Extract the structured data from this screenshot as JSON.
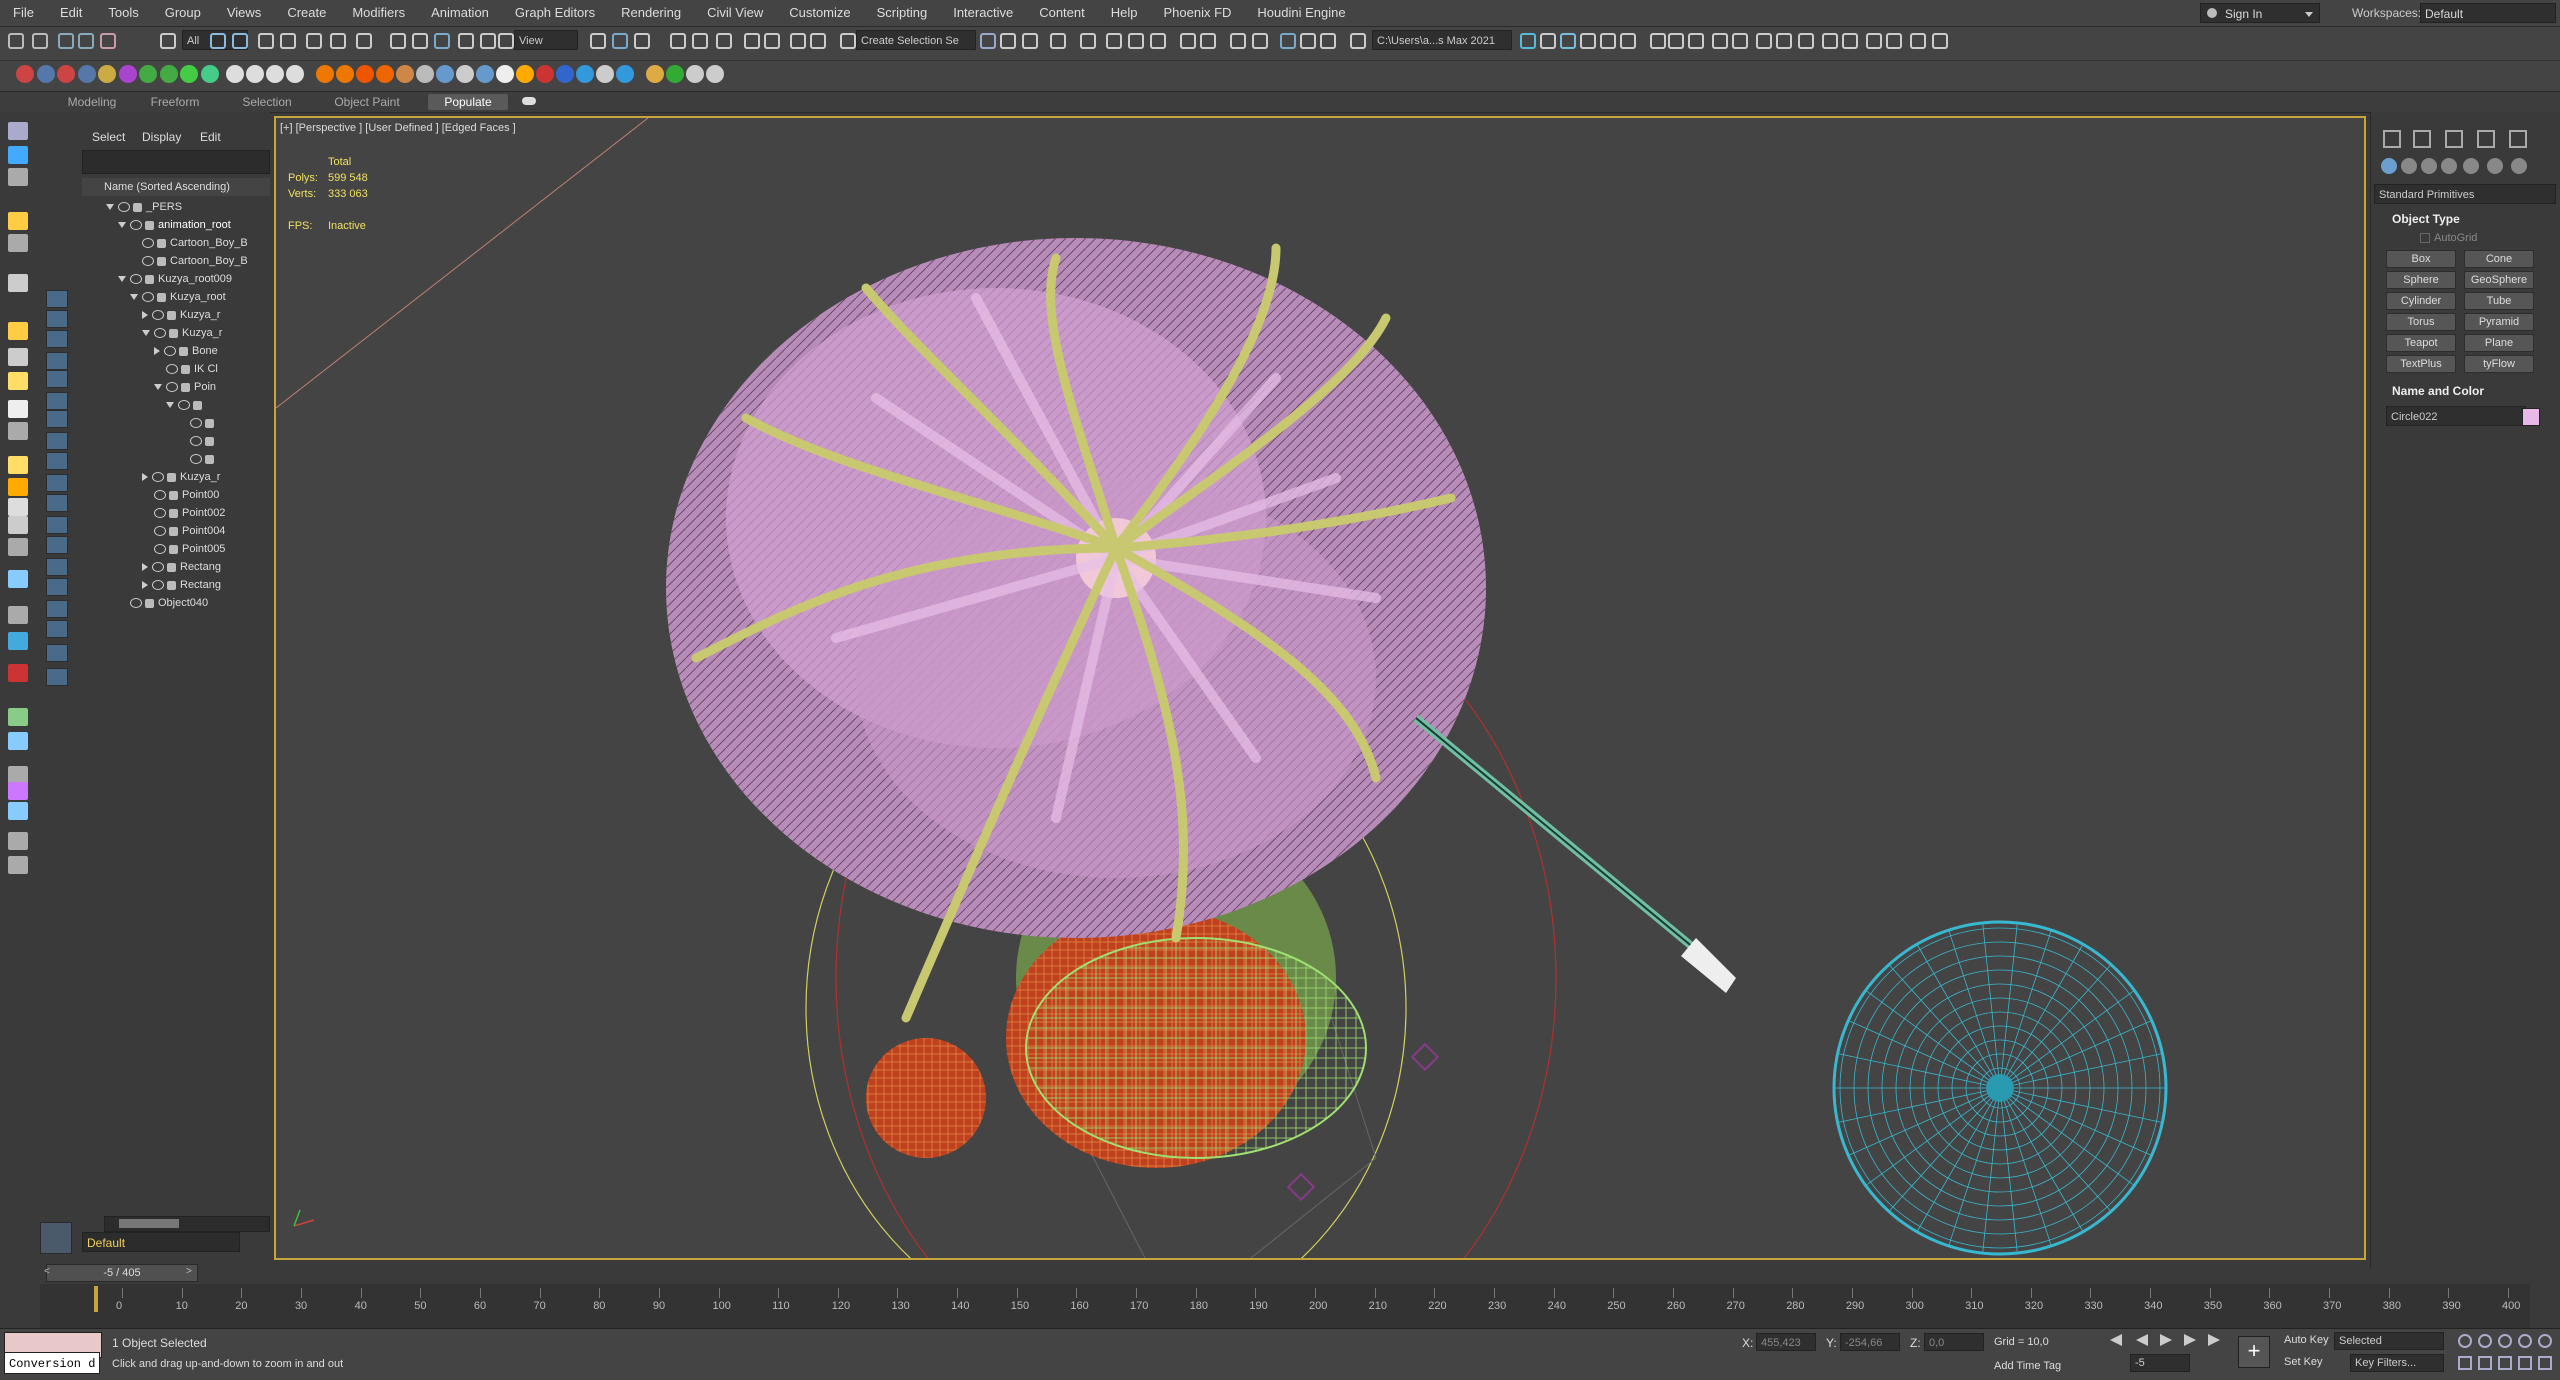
{
  "menubar": {
    "items": [
      "File",
      "Edit",
      "Tools",
      "Group",
      "Views",
      "Create",
      "Modifiers",
      "Animation",
      "Graph Editors",
      "Rendering",
      "Civil View",
      "Customize",
      "Scripting",
      "Interactive",
      "Content",
      "Help",
      "Phoenix FD",
      "Houdini Engine"
    ],
    "sign_in": "Sign In",
    "workspaces_label": "Workspaces:",
    "workspace_value": "Default"
  },
  "toolbar": {
    "selection_filter": "All",
    "ref_coord": "View",
    "selection_set": "Create Selection Se",
    "path": "C:\\Users\\a...s Max 2021"
  },
  "ribbon": {
    "tabs": [
      "Modeling",
      "Freeform",
      "Selection",
      "Object Paint",
      "Populate"
    ],
    "active": "Populate"
  },
  "scene_explorer": {
    "menu": [
      "Select",
      "Display",
      "Edit"
    ],
    "header": "Name (Sorted Ascending)",
    "rows": [
      "_PERS",
      "animation_root",
      "Cartoon_Boy_B",
      "Cartoon_Boy_B",
      "Kuzya_root009",
      "Kuzya_root",
      "Kuzya_r",
      "Kuzya_r",
      "Bone",
      "IK Cl",
      "Poin",
      "",
      "",
      "",
      "",
      "Kuzya_r",
      "Point00",
      "Point002",
      "Point004",
      "Point005",
      "Rectang",
      "Rectang",
      "Object040"
    ],
    "layer": "Default"
  },
  "viewport": {
    "label": "[+] [Perspective ] [User Defined ] [Edged Faces ]",
    "stats_total": "Total",
    "polys_label": "Polys:",
    "polys_value": "599 548",
    "verts_label": "Verts:",
    "verts_value": "333 063",
    "fps_label": "FPS:",
    "fps_value": "Inactive"
  },
  "command_panel": {
    "category": "Standard Primitives",
    "object_type_title": "Object Type",
    "autogrid": "AutoGrid",
    "buttons": [
      "Box",
      "Cone",
      "Sphere",
      "GeoSphere",
      "Cylinder",
      "Tube",
      "Torus",
      "Pyramid",
      "Teapot",
      "Plane",
      "TextPlus",
      "tyFlow"
    ],
    "name_color_title": "Name and Color",
    "object_name": "Circle022",
    "object_color": "#e8b8e8"
  },
  "timeline": {
    "frame_indicator": "-5 / 405",
    "ticks": [
      "0",
      "10",
      "20",
      "30",
      "40",
      "50",
      "60",
      "70",
      "80",
      "90",
      "100",
      "110",
      "120",
      "130",
      "140",
      "150",
      "160",
      "170",
      "180",
      "190",
      "200",
      "210",
      "220",
      "230",
      "240",
      "250",
      "260",
      "270",
      "280",
      "290",
      "300",
      "310",
      "320",
      "330",
      "340",
      "350",
      "360",
      "370",
      "380",
      "390",
      "400"
    ]
  },
  "status": {
    "maxscript": "Conversion d",
    "selected": "1 Object Selected",
    "prompt": "Click and drag up-and-down to zoom in and out",
    "x_label": "X:",
    "x_value": "455,423",
    "y_label": "Y:",
    "y_value": "-254,66",
    "z_label": "Z:",
    "z_value": "0,0",
    "grid": "Grid = 10,0",
    "add_time_tag": "Add Time Tag",
    "auto_key": "Auto Key",
    "set_key": "Set Key",
    "key_mode": "Selected",
    "key_filters": "Key Filters...",
    "frame_value": "-5"
  },
  "colors": {
    "hair": "#d8a0d8",
    "strands": "#c8c870",
    "body": "#c04020",
    "net": "#38b8d0",
    "viewport_border": "#c9a43a"
  }
}
